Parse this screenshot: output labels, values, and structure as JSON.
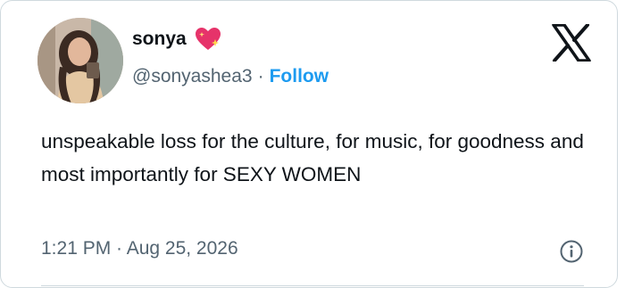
{
  "author": {
    "name": "sonya",
    "handle": "@sonyashea3",
    "separator": "·",
    "follow_label": "Follow",
    "name_badge_icon": "sparkling-heart-icon"
  },
  "tweet": {
    "text": "unspeakable loss for the culture, for music, for goodness and most importantly for SEXY WOMEN",
    "timestamp": "1:21 PM · Aug 25, 2026"
  },
  "icons": {
    "brand": "x-logo-icon",
    "info": "info-icon"
  },
  "colors": {
    "follow": "#1d9bf0",
    "heart": "#e6336a",
    "secondary_text": "#536471",
    "primary_text": "#0f1419"
  }
}
